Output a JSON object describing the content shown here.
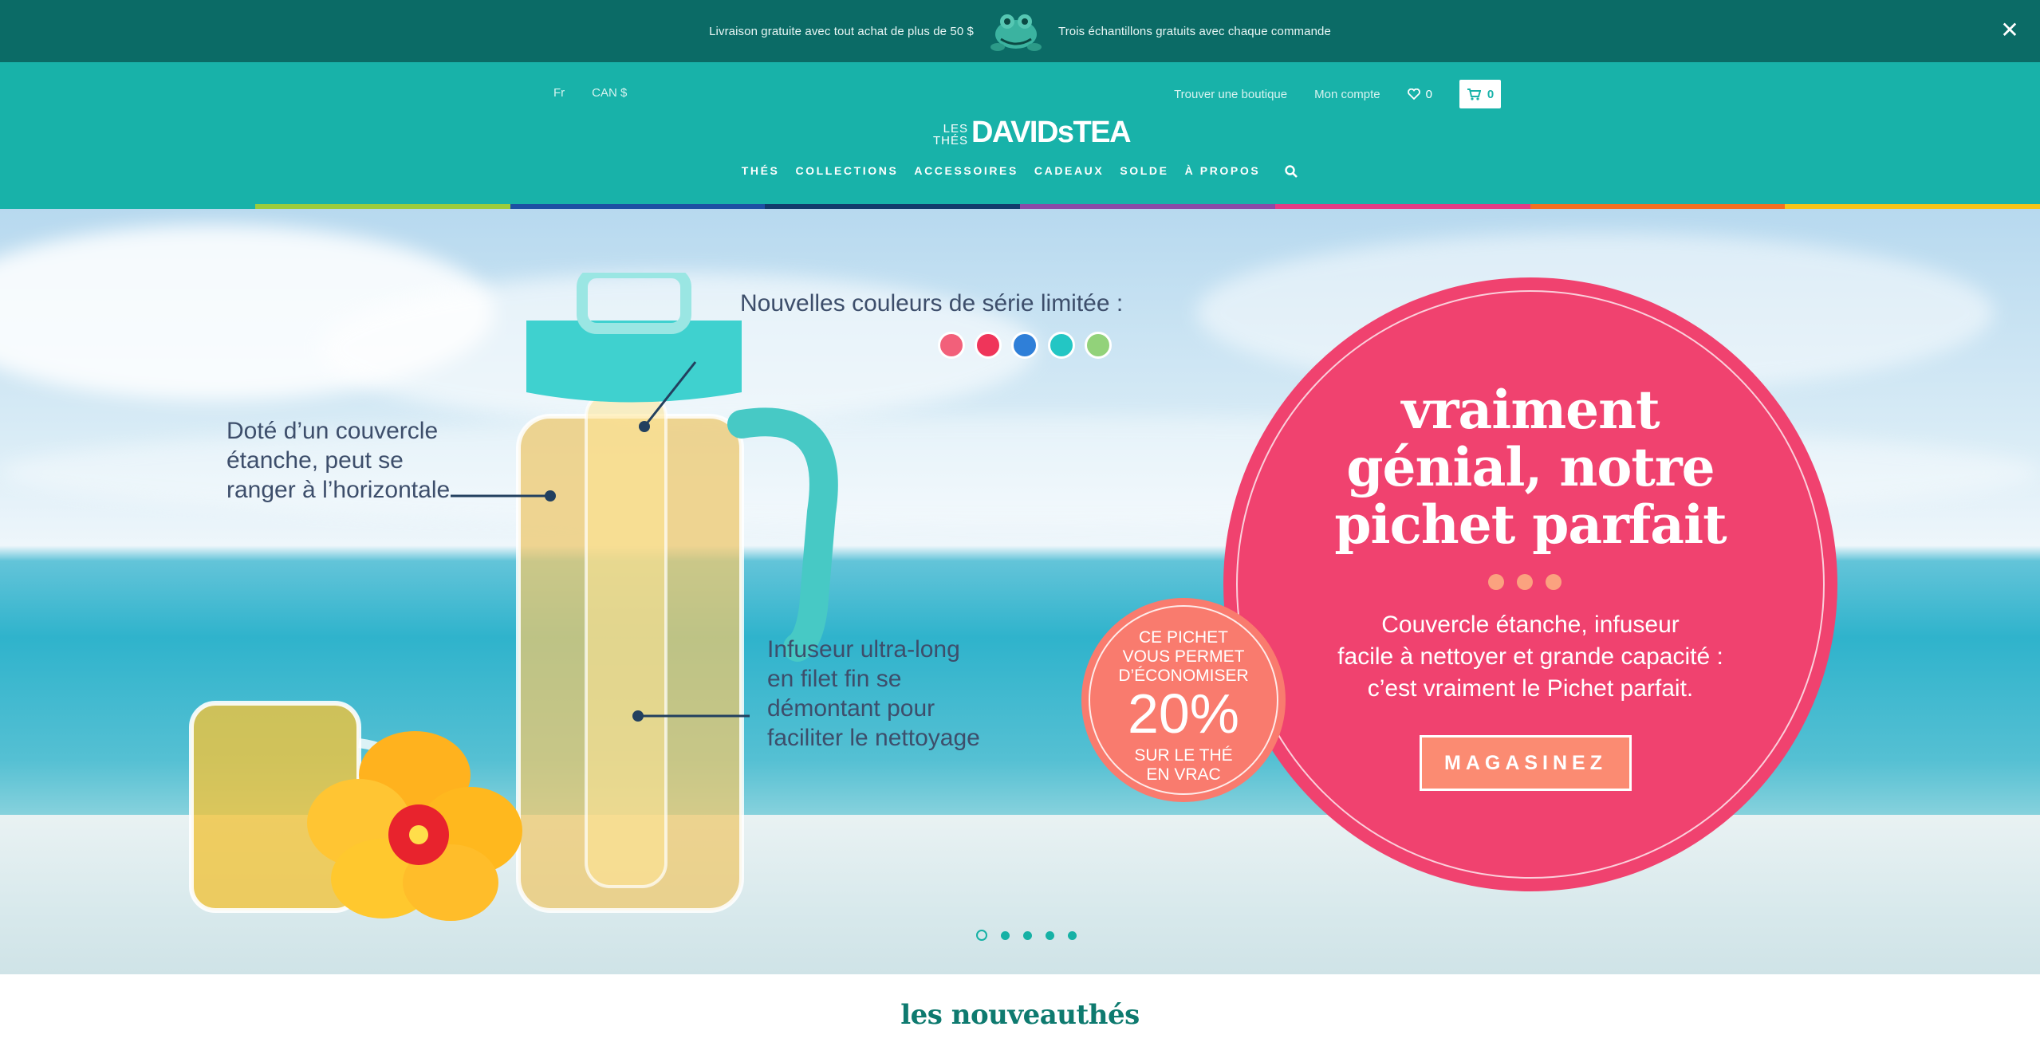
{
  "promo": {
    "left_text": "Livraison gratuite avec tout achat de plus de 50 $",
    "right_text": "Trois échantillons gratuits avec chaque commande",
    "close_icon": "close-icon"
  },
  "header": {
    "lang": "Fr",
    "currency": "CAN $",
    "find_store": "Trouver une boutique",
    "account": "Mon compte",
    "wishlist_count": "0",
    "cart_count": "0",
    "logo_les": "LES",
    "logo_thes": "THÉS",
    "logo_brand": "DAVIDsTEA",
    "nav": [
      "THÉS",
      "COLLECTIONS",
      "ACCESSOIRES",
      "CADEAUX",
      "SOLDE",
      "À PROPOS"
    ],
    "stripe_colors": [
      "#18b2a9",
      "#9ccc3c",
      "#1d4fa3",
      "#123a6b",
      "#8a4aa8",
      "#e33b86",
      "#f37021",
      "#f6c419"
    ]
  },
  "hero": {
    "annot_colors_title": "Nouvelles couleurs de série limitée :",
    "annot_lid": [
      "Doté d’un couvercle",
      "étanche, peut se",
      "ranger à l’horizontale"
    ],
    "annot_infuser": [
      "Infuseur ultra-long",
      "en filet fin se",
      "démontant pour",
      "faciliter le nettoyage"
    ],
    "swatches": [
      "#f2607a",
      "#ef355a",
      "#2f7fd8",
      "#23c6c4",
      "#92d27a"
    ],
    "headline": [
      "vraiment",
      "génial, notre",
      "pichet parfait"
    ],
    "body": [
      "Couvercle étanche, infuseur",
      "facile à nettoyer et grande capacité :",
      "c’est vraiment le Pichet parfait."
    ],
    "cta": "MAGASINEZ",
    "badge_top": [
      "CE PICHET",
      "VOUS PERMET",
      "D’ÉCONOMISER"
    ],
    "badge_pct": "20%",
    "badge_bottom": [
      "SUR LE THÉ",
      "EN VRAC"
    ],
    "slides": 5,
    "active_slide": 1
  },
  "section": {
    "title": "les nouveauthés"
  }
}
